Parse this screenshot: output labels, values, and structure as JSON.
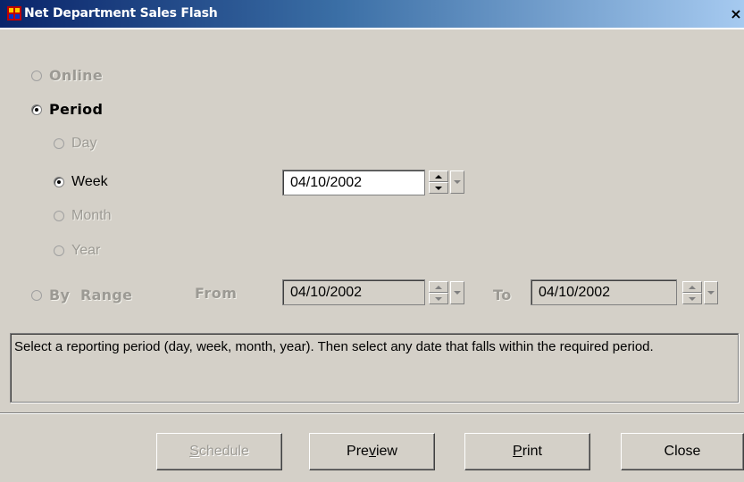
{
  "window": {
    "title": "Net Department Sales Flash",
    "close_glyph": "×"
  },
  "options": {
    "online": {
      "label": "Online"
    },
    "period": {
      "label": "Period"
    },
    "day": {
      "label": "Day"
    },
    "week": {
      "label": "Week"
    },
    "month": {
      "label": "Month"
    },
    "year": {
      "label": "Year"
    },
    "by_range": {
      "label": "By  Range"
    }
  },
  "week_date": {
    "value": "04/10/2002"
  },
  "range": {
    "from_label": "From",
    "from_value": "04/10/2002",
    "to_label": "To",
    "to_value": "04/10/2002"
  },
  "info": {
    "text": "Select a reporting period (day, week, month, year). Then select any date that falls within the required period."
  },
  "buttons": {
    "schedule": {
      "pre": "",
      "ul": "S",
      "post": "chedule"
    },
    "preview": {
      "pre": "Pre",
      "ul": "v",
      "post": "iew"
    },
    "print": {
      "pre": "",
      "ul": "P",
      "post": "rint"
    },
    "close": {
      "label": "Close"
    }
  }
}
